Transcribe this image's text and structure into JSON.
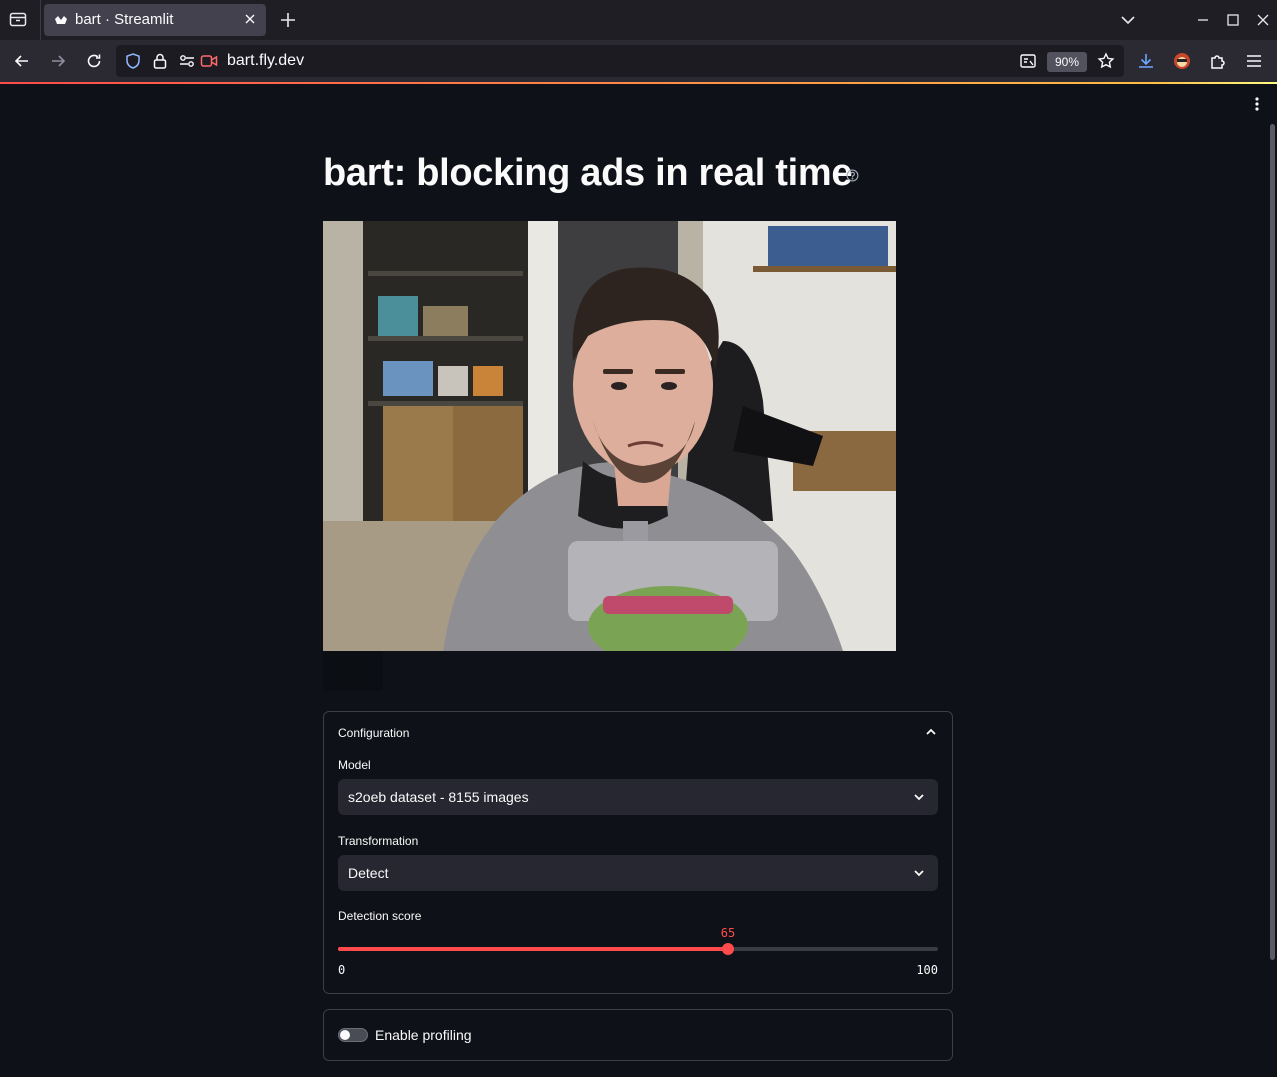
{
  "browser": {
    "tab_title": "bart · Streamlit",
    "url": "bart.fly.dev",
    "zoom": "90%"
  },
  "page": {
    "title": "bart: blocking ads in real time",
    "config": {
      "header": "Configuration",
      "model_label": "Model",
      "model_value": "s2oeb dataset - 8155 images",
      "transformation_label": "Transformation",
      "transformation_value": "Detect",
      "score_label": "Detection score",
      "score_value": 65,
      "score_min": 0,
      "score_max": 100
    },
    "profiling": {
      "label": "Enable profiling",
      "enabled": false
    }
  },
  "colors": {
    "accent": "#ff4b4b",
    "background": "#0e1117",
    "widget": "#262730"
  },
  "icons": [
    "tab-list-icon",
    "streamlit-favicon",
    "close-icon",
    "plus-icon",
    "chevron-down-icon",
    "minimize-icon",
    "maximize-icon",
    "back-icon",
    "forward-icon",
    "reload-icon",
    "shield-icon",
    "lock-icon",
    "permissions-icon",
    "camera-icon",
    "reader-icon",
    "star-icon",
    "download-icon",
    "extension-avatar-icon",
    "puzzle-icon",
    "menu-icon",
    "kebab-icon",
    "help-icon",
    "chevron-up-icon"
  ]
}
